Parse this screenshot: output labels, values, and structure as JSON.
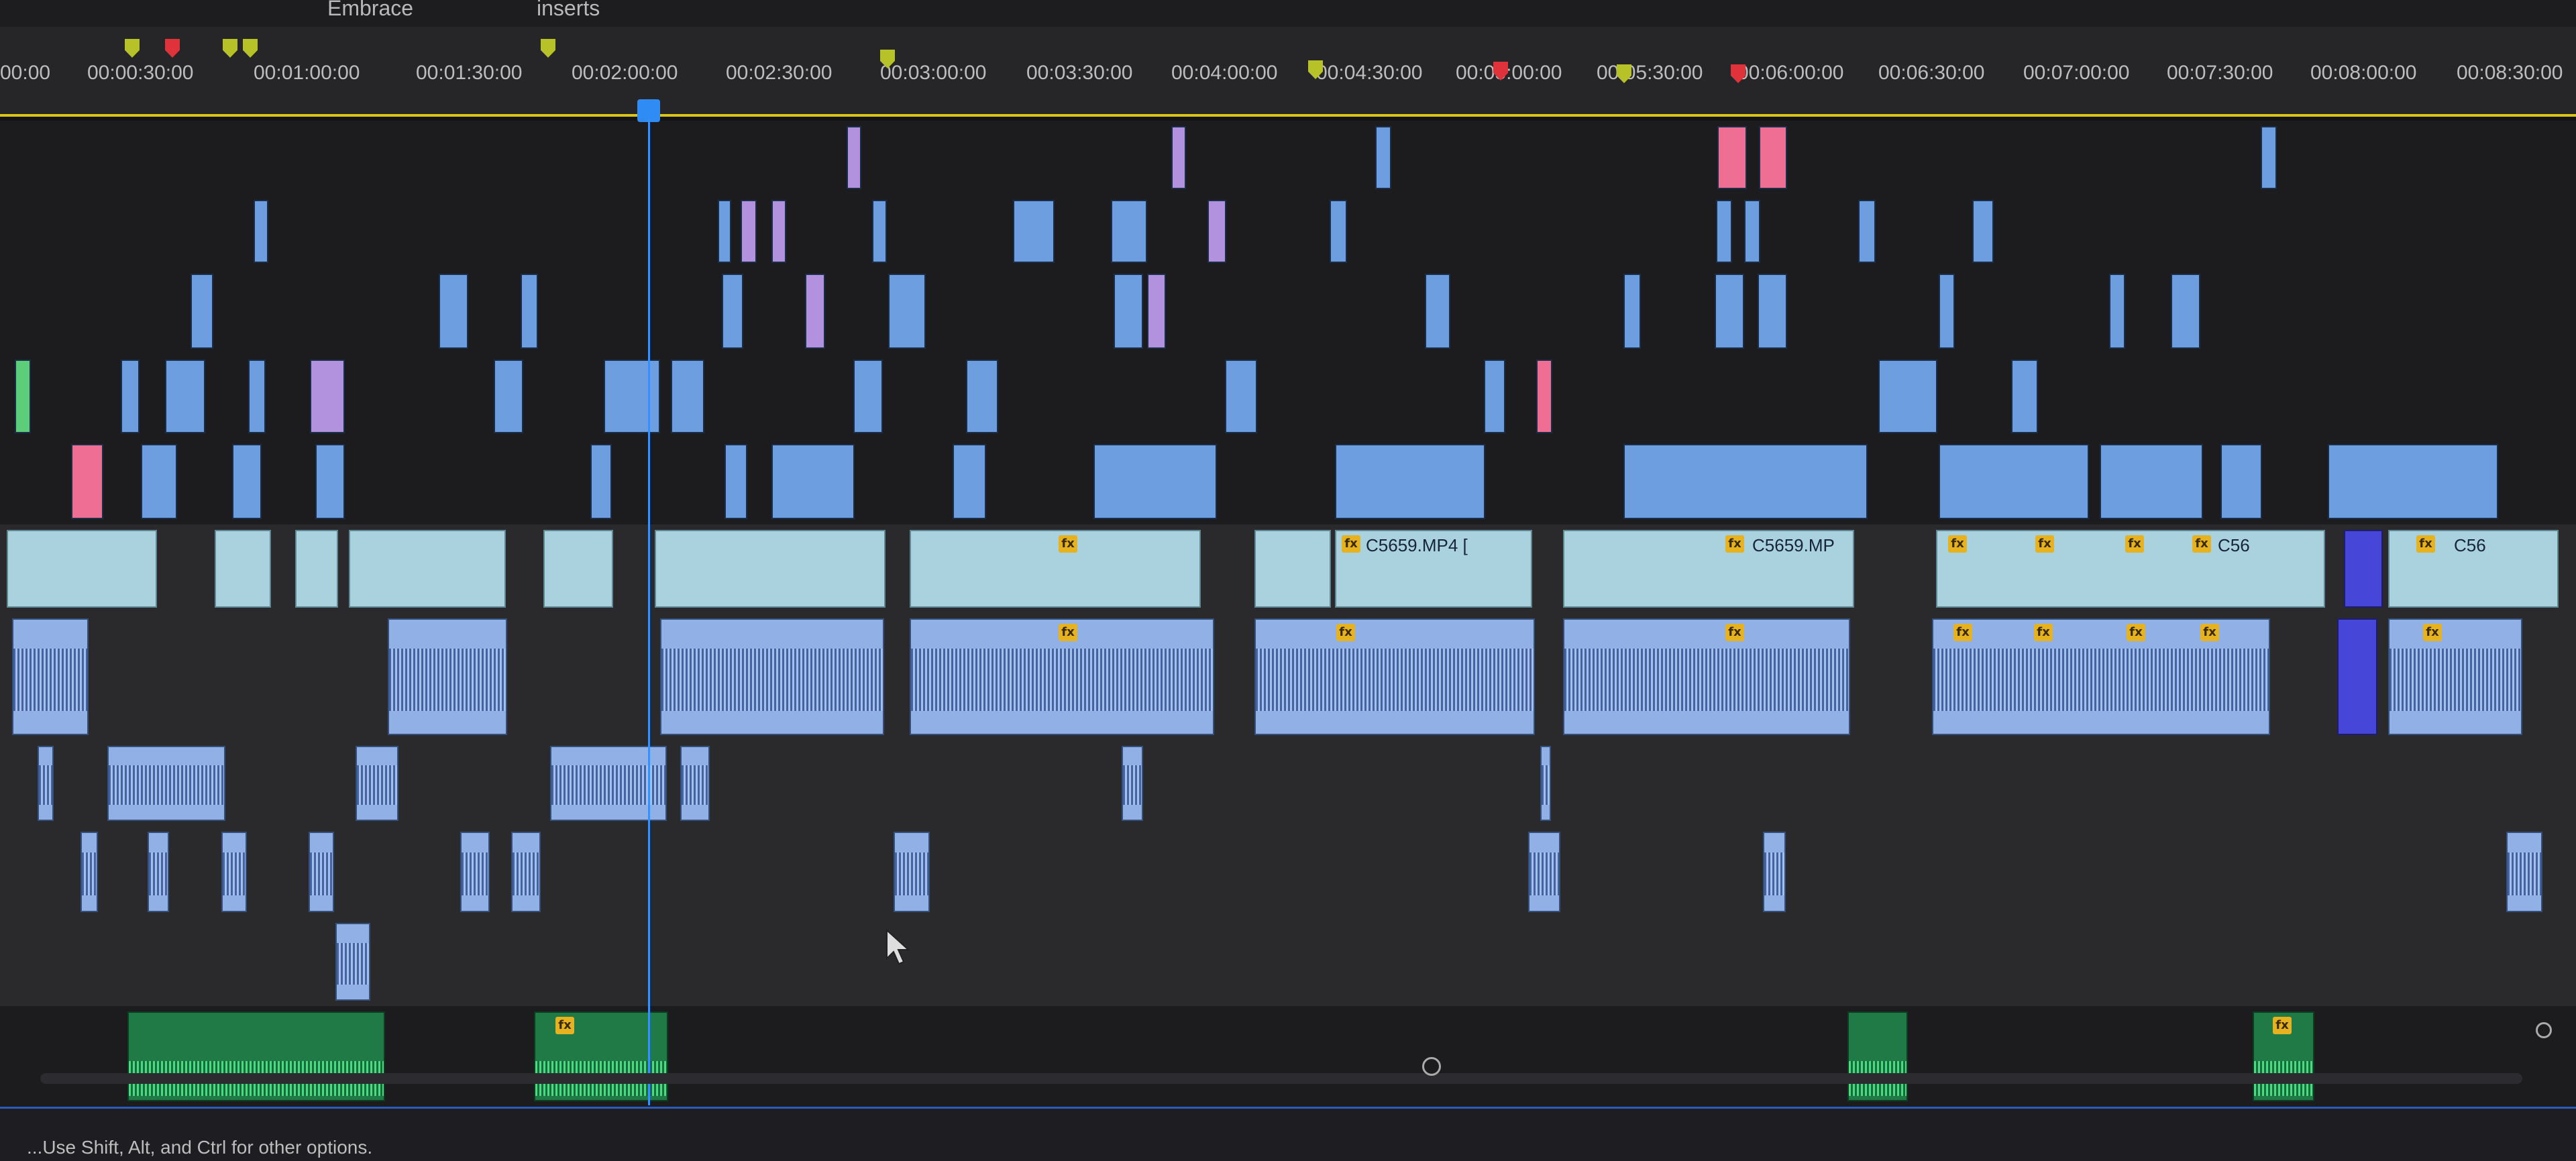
{
  "sequence_tabs": [
    "Embrace",
    "inserts"
  ],
  "ruler": {
    "timecodes": [
      "00:00",
      "00:00:30:00",
      "00:01:00:00",
      "00:01:30:00",
      "00:02:00:00",
      "00:02:30:00",
      "00:03:00:00",
      "00:03:30:00",
      "00:04:00:00",
      "00:04:30:00",
      "00:05:00:00",
      "00:05:30:00",
      "00:06:00:00",
      "00:06:30:00",
      "00:07:00:00",
      "00:07:30:00",
      "00:08:00:00",
      "00:08:30:00"
    ],
    "marker_colors": {
      "yellow": "#b6c227",
      "red": "#e0323a"
    },
    "work_area_color": "#d9c41a"
  },
  "playhead": {
    "color": "#2f8cf5",
    "position_timecode": "00:02:00:00"
  },
  "clips": {
    "clip_name_1": "C5659.MP4 [",
    "clip_name_2": "C5659.MP",
    "clip_name_3": "C56",
    "clip_name_4": "C56",
    "fx_badge": "fx"
  },
  "status_bar": {
    "hint_text": "...Use Shift, Alt, and Ctrl for other options."
  },
  "colors": {
    "video_clip": "#6c9ee0",
    "audio_clip": "#90b0e6",
    "adjustment_clip": "#b292de",
    "audio_green": "#1f7a45",
    "accent": "#2a5bb8"
  }
}
